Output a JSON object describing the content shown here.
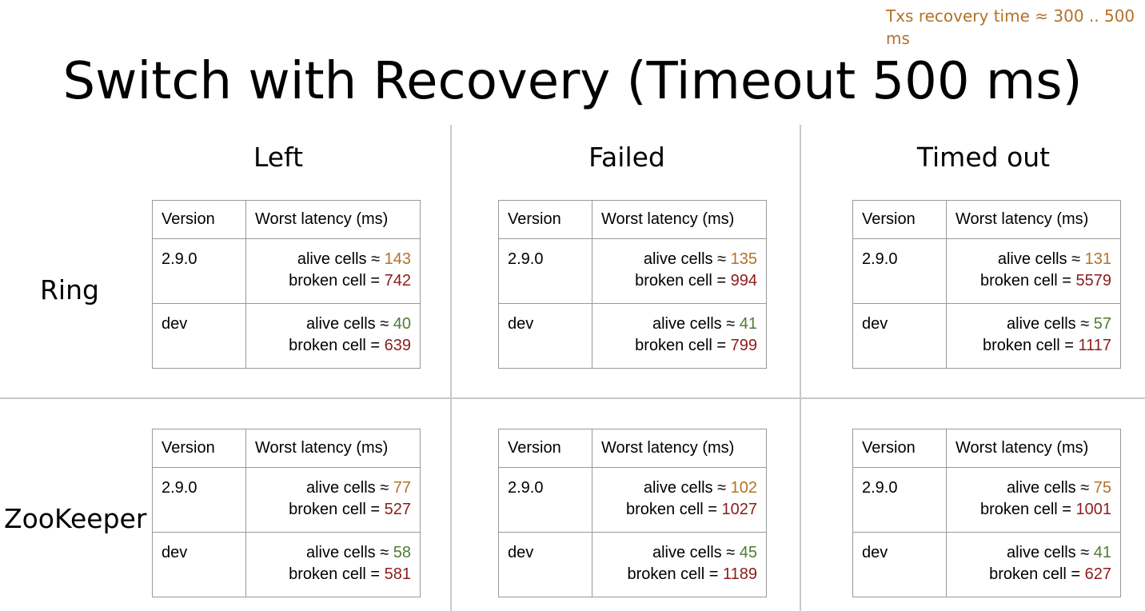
{
  "note": "Txs recovery time ≈ 300 .. 500 ms",
  "title": "Switch with Recovery (Timeout 500 ms)",
  "columns": [
    "Left",
    "Failed",
    "Timed out"
  ],
  "rows": [
    "Ring",
    "ZooKeeper"
  ],
  "header": {
    "version": "Version",
    "latency": "Worst latency (ms)"
  },
  "labels": {
    "alive": "alive cells ≈ ",
    "broken": "broken cell = "
  },
  "colors": {
    "amber": "#b4712a",
    "green": "#4e7c34",
    "red": "#8c1c1c",
    "grid": "#c8c8c8"
  },
  "tables": {
    "ring_left": {
      "v1": "2.9.0",
      "v1_alive": "143",
      "v1_broken": "742",
      "v2": "dev",
      "v2_alive": "40",
      "v2_broken": "639"
    },
    "ring_failed": {
      "v1": "2.9.0",
      "v1_alive": "135",
      "v1_broken": "994",
      "v2": "dev",
      "v2_alive": "41",
      "v2_broken": "799"
    },
    "ring_timedout": {
      "v1": "2.9.0",
      "v1_alive": "131",
      "v1_broken": "5579",
      "v2": "dev",
      "v2_alive": "57",
      "v2_broken": "1117"
    },
    "zk_left": {
      "v1": "2.9.0",
      "v1_alive": "77",
      "v1_broken": "527",
      "v2": "dev",
      "v2_alive": "58",
      "v2_broken": "581"
    },
    "zk_failed": {
      "v1": "2.9.0",
      "v1_alive": "102",
      "v1_broken": "1027",
      "v2": "dev",
      "v2_alive": "45",
      "v2_broken": "1189"
    },
    "zk_timedout": {
      "v1": "2.9.0",
      "v1_alive": "75",
      "v1_broken": "1001",
      "v2": "dev",
      "v2_alive": "41",
      "v2_broken": "627"
    }
  }
}
